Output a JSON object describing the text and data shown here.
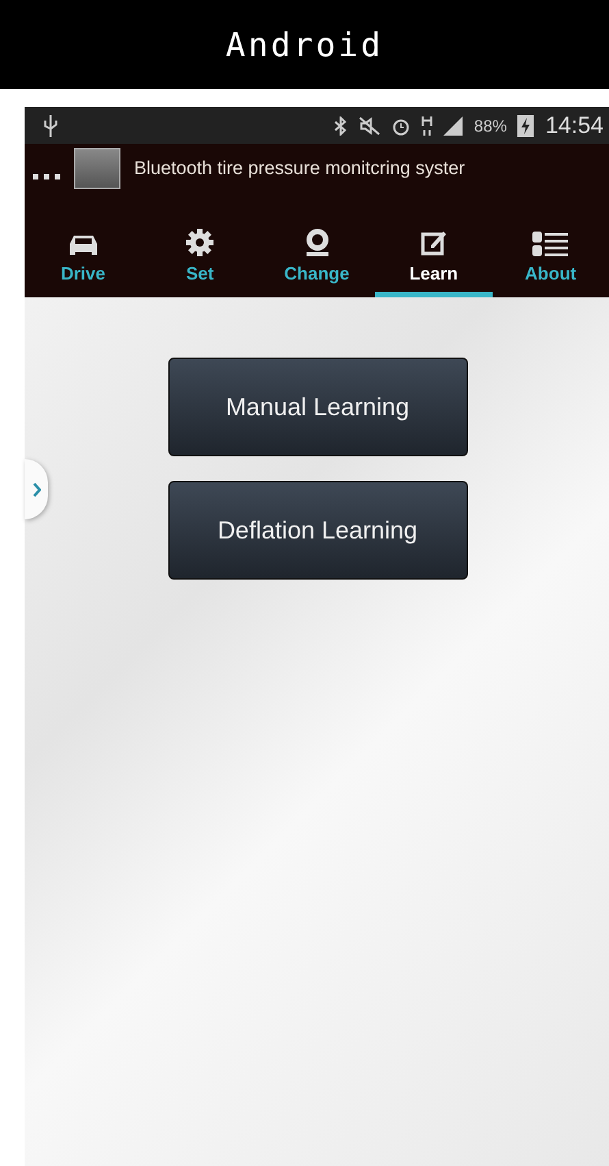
{
  "header": {
    "title": "Android"
  },
  "status_bar": {
    "battery": "88%",
    "time": "14:54"
  },
  "app_bar": {
    "title": "Bluetooth tire pressure monitcring syster"
  },
  "tabs": [
    {
      "label": "Drive",
      "selected": false
    },
    {
      "label": "Set",
      "selected": false
    },
    {
      "label": "Change",
      "selected": false
    },
    {
      "label": "Learn",
      "selected": true
    },
    {
      "label": "About",
      "selected": false
    }
  ],
  "buttons": [
    {
      "label": "Manual Learning"
    },
    {
      "label": "Deflation Learning"
    }
  ]
}
